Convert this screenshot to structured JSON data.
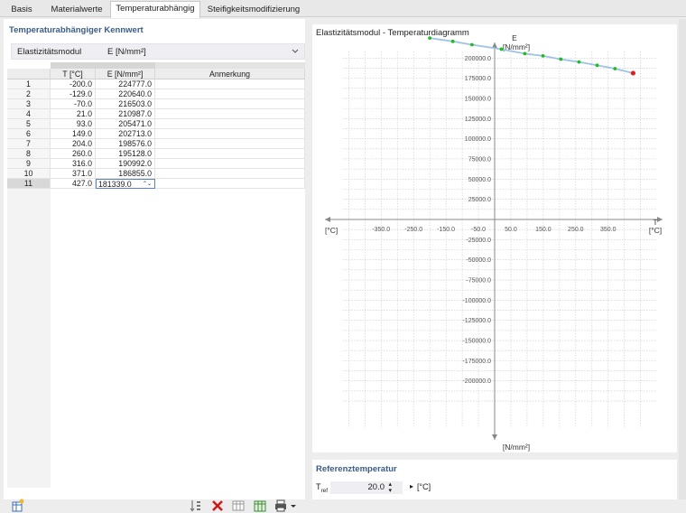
{
  "tabs": [
    {
      "label": "Basis",
      "active": false
    },
    {
      "label": "Materialwerte",
      "active": false
    },
    {
      "label": "Temperaturabhängig",
      "active": true
    },
    {
      "label": "Steifigkeitsmodifizierung",
      "active": false
    }
  ],
  "left": {
    "section_title": "Temperaturabhängiger Kennwert",
    "property_label": "Elastizitätsmodul",
    "property_value": "E [N/mm²]",
    "columns": [
      "",
      "T [°C]",
      "E [N/mm²]",
      "Anmerkung"
    ],
    "rows": [
      {
        "n": "1",
        "t": "-200.0",
        "e": "224777.0",
        "note": ""
      },
      {
        "n": "2",
        "t": "-129.0",
        "e": "220640.0",
        "note": ""
      },
      {
        "n": "3",
        "t": "-70.0",
        "e": "216503.0",
        "note": ""
      },
      {
        "n": "4",
        "t": "21.0",
        "e": "210987.0",
        "note": ""
      },
      {
        "n": "5",
        "t": "93.0",
        "e": "205471.0",
        "note": ""
      },
      {
        "n": "6",
        "t": "149.0",
        "e": "202713.0",
        "note": ""
      },
      {
        "n": "7",
        "t": "204.0",
        "e": "198576.0",
        "note": ""
      },
      {
        "n": "8",
        "t": "260.0",
        "e": "195128.0",
        "note": ""
      },
      {
        "n": "9",
        "t": "316.0",
        "e": "190992.0",
        "note": ""
      },
      {
        "n": "10",
        "t": "371.0",
        "e": "186855.0",
        "note": ""
      },
      {
        "n": "11",
        "t": "427.0",
        "e": "181339.0",
        "note": ""
      }
    ],
    "selected_row": 10
  },
  "chart_title": "Elastizitätsmodul - Temperaturdiagramm",
  "chart_data": {
    "type": "line",
    "title": "Elastizitätsmodul - Temperaturdiagramm",
    "xlabel": "T",
    "xunit": "[°C]",
    "xunit_left": "[°C]",
    "ylabel": "E",
    "yunit_top": "[N/mm²]",
    "yunit_bottom": "[N/mm²]",
    "xlim": [
      -600,
      600
    ],
    "ylim": [
      -250000,
      250000
    ],
    "x_ticks": [
      -350,
      -250,
      -150,
      -50,
      50,
      150,
      250,
      350
    ],
    "x_tick_labels": [
      "-350.0",
      "-250.0",
      "-150.0",
      "-50.0",
      "50.0",
      "150.0",
      "250.0",
      "350.0"
    ],
    "y_ticks": [
      200000,
      175000,
      150000,
      125000,
      100000,
      75000,
      50000,
      25000,
      -25000,
      -50000,
      -75000,
      -100000,
      -125000,
      -150000,
      -175000,
      -200000
    ],
    "y_tick_labels": [
      "200000.0",
      "175000.0",
      "150000.0",
      "125000.0",
      "100000.0",
      "75000.0",
      "50000.0",
      "25000.0",
      "-25000.0",
      "-50000.0",
      "-75000.0",
      "-100000.0",
      "-125000.0",
      "-150000.0",
      "-175000.0",
      "-200000.0"
    ],
    "grid": true,
    "series": [
      {
        "x": [
          -200,
          -129,
          -70,
          21,
          93,
          149,
          204,
          260,
          316,
          371,
          427
        ],
        "y": [
          224777,
          220640,
          216503,
          210987,
          205471,
          202713,
          198576,
          195128,
          190992,
          186855,
          181339
        ],
        "line_color": "#9cc3e6",
        "point_color": "#22bb22",
        "selected_color": "#e02020"
      }
    ]
  },
  "reference": {
    "title": "Referenztemperatur",
    "label": "T",
    "label_sub": "ref",
    "value": "20.0",
    "unit": "[°C]"
  },
  "colors": {
    "section_title": "#3a5c88",
    "accent_blue": "#2a6cc8",
    "delete_red": "#d01818"
  }
}
